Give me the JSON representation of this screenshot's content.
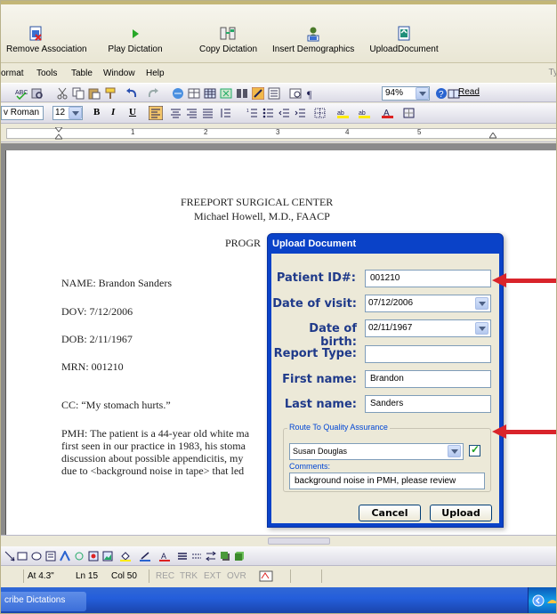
{
  "toolbar": {
    "buttons": [
      {
        "label": "Remove Association",
        "icon": "remove-association-icon"
      },
      {
        "label": "Play Dictation",
        "icon": "play-icon"
      },
      {
        "label": "Copy Dictation",
        "icon": "copy-dictation-icon"
      },
      {
        "label": "Insert Demographics",
        "icon": "insert-demographics-icon"
      },
      {
        "label": "UploadDocument",
        "icon": "upload-document-icon"
      }
    ]
  },
  "menu": {
    "items": [
      "ormat",
      "Tools",
      "Table",
      "Window",
      "Help"
    ],
    "help_box_fragment": "Ty"
  },
  "standard_toolbar": {
    "zoom": "94%",
    "read_label": "Read"
  },
  "format_toolbar": {
    "font_name": "v Roman",
    "font_size": "12",
    "bold": "B",
    "italic": "I",
    "underline": "U"
  },
  "ruler": {
    "numbers": [
      "1",
      "2",
      "3",
      "4",
      "5"
    ]
  },
  "document": {
    "header_line1": "FREEPORT SURGICAL CENTER",
    "header_line2": "Michael Howell, M.D., FAACP",
    "section_fragment": "PROGR",
    "name": "NAME: Brandon Sanders",
    "dov": "DOV: 7/12/2006",
    "dob": "DOB: 2/11/1967",
    "mrn": "MRN: 001210",
    "cc": "CC: “My stomach hurts.”",
    "pmh_line1": "PMH: The patient is a 44-year old white ma",
    "pmh_line2": "first seen in our practice in 1983, his stoma",
    "pmh_line3": "discussion about possible appendicitis, my",
    "pmh_line4": "due to <background noise in tape> that led"
  },
  "dialog": {
    "title": "Upload Document",
    "patient_id_label": "Patient ID#:",
    "patient_id_value": "001210",
    "date_of_visit_label": "Date of visit:",
    "date_of_visit_value": "07/12/2006",
    "date_of_birth_label": "Date of birth:",
    "date_of_birth_value": "02/11/1967",
    "report_type_label": "Report Type:",
    "report_type_value": "",
    "first_name_label": "First name:",
    "first_name_value": "Brandon",
    "last_name_label": "Last name:",
    "last_name_value": "Sanders",
    "qa_group_label": "Route To Quality Assurance",
    "qa_reviewer": "Susan Douglas",
    "qa_checked": true,
    "comments_label": "Comments:",
    "comments_value": "background noise in PMH, please review",
    "cancel_label": "Cancel",
    "upload_label": "Upload"
  },
  "status": {
    "at": "At 4.3\"",
    "ln": "Ln 15",
    "col": "Col 50",
    "rec": "REC",
    "trk": "TRK",
    "ext": "EXT",
    "ovr": "OVR"
  },
  "taskbar": {
    "button_label": "cribe Dictations"
  },
  "colors": {
    "dialog_title_bar": "#0a42c8",
    "label_blue": "#1f3a8a",
    "arrow_red": "#d9242b"
  }
}
